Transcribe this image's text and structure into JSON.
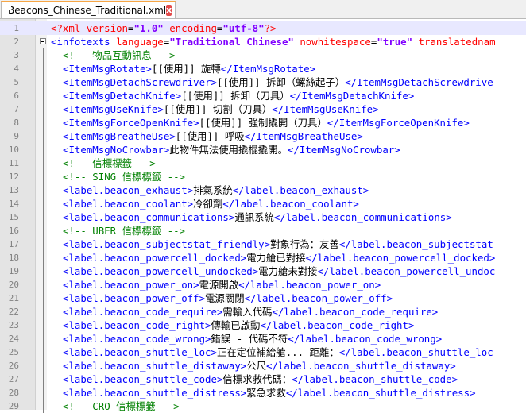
{
  "tab": {
    "title": "Beacons_Chinese_Traditional.xml",
    "close_label": "x"
  },
  "lines": [
    {
      "n": "1",
      "t": "pi",
      "parts": [
        [
          "pi",
          "<?xml "
        ],
        [
          "attr",
          "version"
        ],
        [
          "txt",
          "="
        ],
        [
          "val",
          "\"1.0\""
        ],
        [
          "attr",
          " encoding"
        ],
        [
          "txt",
          "="
        ],
        [
          "val",
          "\"utf-8\""
        ],
        [
          "pi",
          "?>"
        ]
      ]
    },
    {
      "n": "2",
      "t": "root",
      "parts": [
        [
          "tag",
          "<infotexts "
        ],
        [
          "attr",
          "language"
        ],
        [
          "txt",
          "="
        ],
        [
          "val",
          "\"Traditional Chinese\""
        ],
        [
          "attr",
          " nowhitespace"
        ],
        [
          "txt",
          "="
        ],
        [
          "val",
          "\"true\""
        ],
        [
          "attr",
          " translatednam"
        ]
      ]
    },
    {
      "n": "3",
      "parts": [
        [
          "cm",
          "<!-- 物品互動訊息 -->"
        ]
      ]
    },
    {
      "n": "4",
      "parts": [
        [
          "tag",
          "<ItemMsgRotate>"
        ],
        [
          "txt",
          "[[使用]] 旋轉"
        ],
        [
          "tag",
          "</ItemMsgRotate>"
        ]
      ]
    },
    {
      "n": "5",
      "parts": [
        [
          "tag",
          "<ItemMsgDetachScrewdriver>"
        ],
        [
          "txt",
          "[[使用]] 拆卸（螺絲起子）"
        ],
        [
          "tag",
          "</ItemMsgDetachScrewdrive"
        ]
      ]
    },
    {
      "n": "6",
      "parts": [
        [
          "tag",
          "<ItemMsgDetachKnife>"
        ],
        [
          "txt",
          "[[使用]] 拆卸（刀具）"
        ],
        [
          "tag",
          "</ItemMsgDetachKnife>"
        ]
      ]
    },
    {
      "n": "7",
      "parts": [
        [
          "tag",
          "<ItemMsgUseKnife>"
        ],
        [
          "txt",
          "[[使用]] 切割（刀具）"
        ],
        [
          "tag",
          "</ItemMsgUseKnife>"
        ]
      ]
    },
    {
      "n": "8",
      "parts": [
        [
          "tag",
          "<ItemMsgForceOpenKnife>"
        ],
        [
          "txt",
          "[[使用]] 強制撬開（刀具）"
        ],
        [
          "tag",
          "</ItemMsgForceOpenKnife>"
        ]
      ]
    },
    {
      "n": "9",
      "parts": [
        [
          "tag",
          "<ItemMsgBreatheUse>"
        ],
        [
          "txt",
          "[[使用]] 呼吸"
        ],
        [
          "tag",
          "</ItemMsgBreatheUse>"
        ]
      ]
    },
    {
      "n": "10",
      "parts": [
        [
          "tag",
          "<ItemMsgNoCrowbar>"
        ],
        [
          "txt",
          "此物件無法使用撬棍撬開。"
        ],
        [
          "tag",
          "</ItemMsgNoCrowbar>"
        ]
      ]
    },
    {
      "n": "11",
      "parts": [
        [
          "cm",
          "<!-- 信標標籤 -->"
        ]
      ]
    },
    {
      "n": "12",
      "parts": [
        [
          "cm",
          "<!-- SING 信標標籤 -->"
        ]
      ]
    },
    {
      "n": "13",
      "parts": [
        [
          "tag",
          "<label.beacon_exhaust>"
        ],
        [
          "txt",
          "排氣系統"
        ],
        [
          "tag",
          "</label.beacon_exhaust>"
        ]
      ]
    },
    {
      "n": "14",
      "parts": [
        [
          "tag",
          "<label.beacon_coolant>"
        ],
        [
          "txt",
          "冷卻劑"
        ],
        [
          "tag",
          "</label.beacon_coolant>"
        ]
      ]
    },
    {
      "n": "15",
      "parts": [
        [
          "tag",
          "<label.beacon_communications>"
        ],
        [
          "txt",
          "通訊系統"
        ],
        [
          "tag",
          "</label.beacon_communications>"
        ]
      ]
    },
    {
      "n": "16",
      "parts": [
        [
          "cm",
          "<!-- UBER 信標標籤 -->"
        ]
      ]
    },
    {
      "n": "17",
      "parts": [
        [
          "tag",
          "<label.beacon_subjectstat_friendly>"
        ],
        [
          "txt",
          "對象行為：友善"
        ],
        [
          "tag",
          "</label.beacon_subjectstat"
        ]
      ]
    },
    {
      "n": "18",
      "parts": [
        [
          "tag",
          "<label.beacon_powercell_docked>"
        ],
        [
          "txt",
          "電力艙已對接"
        ],
        [
          "tag",
          "</label.beacon_powercell_docked>"
        ]
      ]
    },
    {
      "n": "19",
      "parts": [
        [
          "tag",
          "<label.beacon_powercell_undocked>"
        ],
        [
          "txt",
          "電力艙未對接"
        ],
        [
          "tag",
          "</label.beacon_powercell_undoc"
        ]
      ]
    },
    {
      "n": "20",
      "parts": [
        [
          "tag",
          "<label.beacon_power_on>"
        ],
        [
          "txt",
          "電源開啟"
        ],
        [
          "tag",
          "</label.beacon_power_on>"
        ]
      ]
    },
    {
      "n": "21",
      "parts": [
        [
          "tag",
          "<label.beacon_power_off>"
        ],
        [
          "txt",
          "電源關閉"
        ],
        [
          "tag",
          "</label.beacon_power_off>"
        ]
      ]
    },
    {
      "n": "22",
      "parts": [
        [
          "tag",
          "<label.beacon_code_require>"
        ],
        [
          "txt",
          "需輸入代碼"
        ],
        [
          "tag",
          "</label.beacon_code_require>"
        ]
      ]
    },
    {
      "n": "23",
      "parts": [
        [
          "tag",
          "<label.beacon_code_right>"
        ],
        [
          "txt",
          "傳輸已啟動"
        ],
        [
          "tag",
          "</label.beacon_code_right>"
        ]
      ]
    },
    {
      "n": "24",
      "parts": [
        [
          "tag",
          "<label.beacon_code_wrong>"
        ],
        [
          "txt",
          "錯誤 - 代碼不符"
        ],
        [
          "tag",
          "</label.beacon_code_wrong>"
        ]
      ]
    },
    {
      "n": "25",
      "parts": [
        [
          "tag",
          "<label.beacon_shuttle_loc>"
        ],
        [
          "txt",
          "正在定位補給艙... 距離："
        ],
        [
          "tag",
          "</label.beacon_shuttle_loc"
        ]
      ]
    },
    {
      "n": "26",
      "parts": [
        [
          "tag",
          "<label.beacon_shuttle_distaway>"
        ],
        [
          "txt",
          "公尺"
        ],
        [
          "tag",
          "</label.beacon_shuttle_distaway>"
        ]
      ]
    },
    {
      "n": "27",
      "parts": [
        [
          "tag",
          "<label.beacon_shuttle_code>"
        ],
        [
          "txt",
          "信標求救代碼："
        ],
        [
          "tag",
          "</label.beacon_shuttle_code>"
        ]
      ]
    },
    {
      "n": "28",
      "parts": [
        [
          "tag",
          "<label.beacon_shuttle_distress>"
        ],
        [
          "txt",
          "緊急求救"
        ],
        [
          "tag",
          "</label.beacon_shuttle_distress>"
        ]
      ]
    },
    {
      "n": "29",
      "parts": [
        [
          "cm",
          "<!-- CRO 信標標籤 -->"
        ]
      ]
    }
  ]
}
